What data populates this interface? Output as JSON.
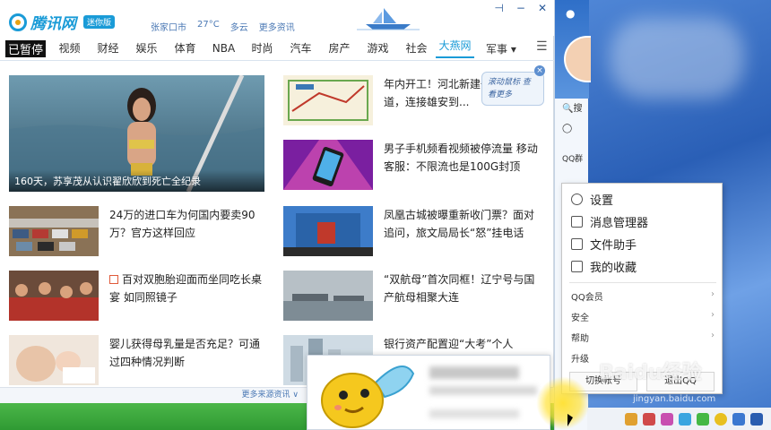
{
  "news_window": {
    "logo_text": "腾讯网",
    "logo_badge": "迷你版",
    "weather": {
      "city": "张家口市",
      "temp": "27°C",
      "condition": "多云",
      "more": "更多资讯"
    },
    "nav": [
      "视频",
      "财经",
      "娱乐",
      "体育",
      "NBA",
      "时尚",
      "汽车",
      "房产",
      "游戏",
      "社会",
      "大燕网"
    ],
    "nav_more": "军事 ▾",
    "pause_label": "已暂停",
    "hero_caption": "160天，苏享茂从认识翟欣欣到死亡全纪录",
    "left_items": [
      {
        "title": "24万的进口车为何国内要卖90万？官方这样回应"
      },
      {
        "title": "百对双胞胎迎面而坐同吃长桌宴 如同照镜子"
      },
      {
        "title": "婴儿获得母乳量是否充足？可通过四种情况判断"
      }
    ],
    "right_items": [
      {
        "title": "年内开工！河北新建一条大通道，连接雄安到..."
      },
      {
        "title": "男子手机频看视频被停流量 移动客服：不限流也是100G封顶"
      },
      {
        "title": "凤凰古城被曝重新收门票？面对追问，旅文局局长“怒”挂电话"
      },
      {
        "title": "“双航母”首次同框！辽宁号与国产航母相聚大连"
      },
      {
        "title": "银行资产配置迎“大考”个人"
      }
    ],
    "tip_text": "滚动鼠标 查看更多",
    "footer_text": "更多来源资讯 ∨"
  },
  "qq_panel": {
    "search_hint": "搜",
    "group_label": "QQ群"
  },
  "qq_menu": {
    "items": [
      {
        "label": "设置",
        "icon": "gear-icon"
      },
      {
        "label": "消息管理器",
        "icon": "message-icon"
      },
      {
        "label": "文件助手",
        "icon": "folder-icon"
      },
      {
        "label": "我的收藏",
        "icon": "bookmark-icon"
      }
    ],
    "submenus": [
      "QQ会员",
      "安全",
      "帮助",
      "升级"
    ],
    "bottom_left": "切换帐号",
    "bottom_right": "退出QQ"
  },
  "watermark": {
    "text": "Baidu经验",
    "sub": "jingyan.baidu.com"
  }
}
